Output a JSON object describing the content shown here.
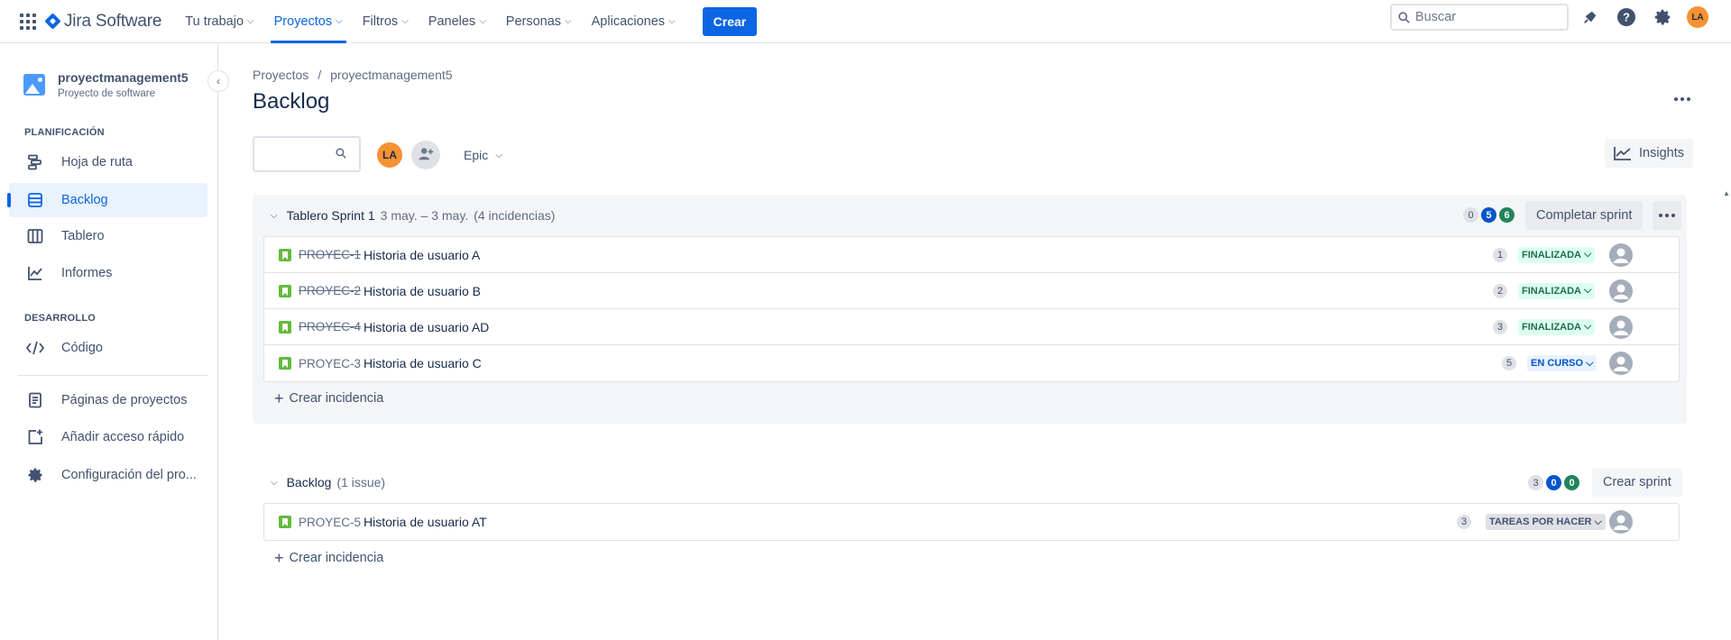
{
  "topnav": {
    "app_name": "Jira Software",
    "menu": [
      {
        "label": "Tu trabajo"
      },
      {
        "label": "Proyectos"
      },
      {
        "label": "Filtros"
      },
      {
        "label": "Paneles"
      },
      {
        "label": "Personas"
      },
      {
        "label": "Aplicaciones"
      }
    ],
    "create_label": "Crear",
    "search_placeholder": "Buscar",
    "user_initials": "LA"
  },
  "sidebar": {
    "project_name": "proyectmanagement5",
    "project_type": "Proyecto de software",
    "section_planning": "PLANIFICACIÓN",
    "section_dev": "DESARROLLO",
    "items": [
      {
        "label": "Hoja de ruta"
      },
      {
        "label": "Backlog"
      },
      {
        "label": "Tablero"
      },
      {
        "label": "Informes"
      },
      {
        "label": "Código"
      },
      {
        "label": "Páginas de proyectos"
      },
      {
        "label": "Añadir acceso rápido"
      },
      {
        "label": "Configuración del pro..."
      }
    ]
  },
  "main": {
    "breadcrumb_1": "Proyectos",
    "breadcrumb_sep": "/",
    "breadcrumb_2": "proyectmanagement5",
    "title": "Backlog",
    "filter_avatar": "LA",
    "epic_label": "Epic",
    "insights_label": "Insights"
  },
  "sprint": {
    "name": "Tablero Sprint 1",
    "dates": "3 may. – 3 may.",
    "issue_count": "(4 incidencias)",
    "counts": [
      "0",
      "5",
      "6"
    ],
    "complete_label": "Completar sprint",
    "create_issue_label": "Crear incidencia",
    "issues": [
      {
        "key": "PROYEC-1",
        "summary": "Historia de usuario A",
        "points": "1",
        "status": "FINALIZADA",
        "kind": "done"
      },
      {
        "key": "PROYEC-2",
        "summary": "Historia de usuario B",
        "points": "2",
        "status": "FINALIZADA",
        "kind": "done"
      },
      {
        "key": "PROYEC-4",
        "summary": "Historia de usuario AD",
        "points": "3",
        "status": "FINALIZADA",
        "kind": "done"
      },
      {
        "key": "PROYEC-3",
        "summary": "Historia de usuario C",
        "points": "5",
        "status": "EN CURSO",
        "kind": "prog"
      }
    ]
  },
  "backlog": {
    "name": "Backlog",
    "issue_count": "(1 issue)",
    "counts": [
      "3",
      "0",
      "0"
    ],
    "create_sprint_label": "Crear sprint",
    "create_issue_label": "Crear incidencia",
    "issues": [
      {
        "key": "PROYEC-5",
        "summary": "Historia de usuario AT",
        "points": "3",
        "status": "TAREAS POR HACER",
        "kind": "todo"
      }
    ]
  },
  "colors": {
    "brand_blue": "#0c66e4",
    "done_green": "#216e4e",
    "story_green": "#63ba3c",
    "avatar_orange": "#f79232"
  }
}
